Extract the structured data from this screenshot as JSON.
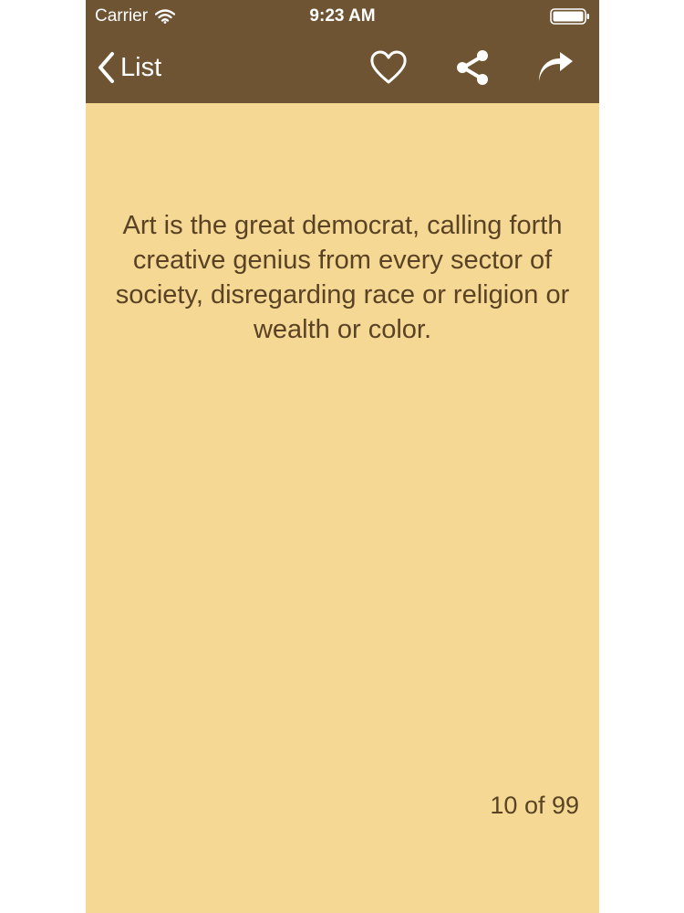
{
  "status_bar": {
    "carrier": "Carrier",
    "time": "9:23 AM",
    "wifi_icon": "wifi-icon",
    "battery_icon": "battery-icon"
  },
  "nav_bar": {
    "back_label": "List",
    "back_icon": "chevron-left-icon",
    "favorite_icon": "heart-icon",
    "share_icon": "share-icon",
    "forward_icon": "forward-arrow-icon"
  },
  "quote": {
    "text": "Art is the great democrat, calling forth creative genius from every sector of society, disregarding race or religion or wealth or color."
  },
  "pager": {
    "counter": "10 of 99"
  },
  "colors": {
    "bar_background": "#6e5433",
    "page_background": "#f5d894",
    "text": "#5a4325"
  }
}
